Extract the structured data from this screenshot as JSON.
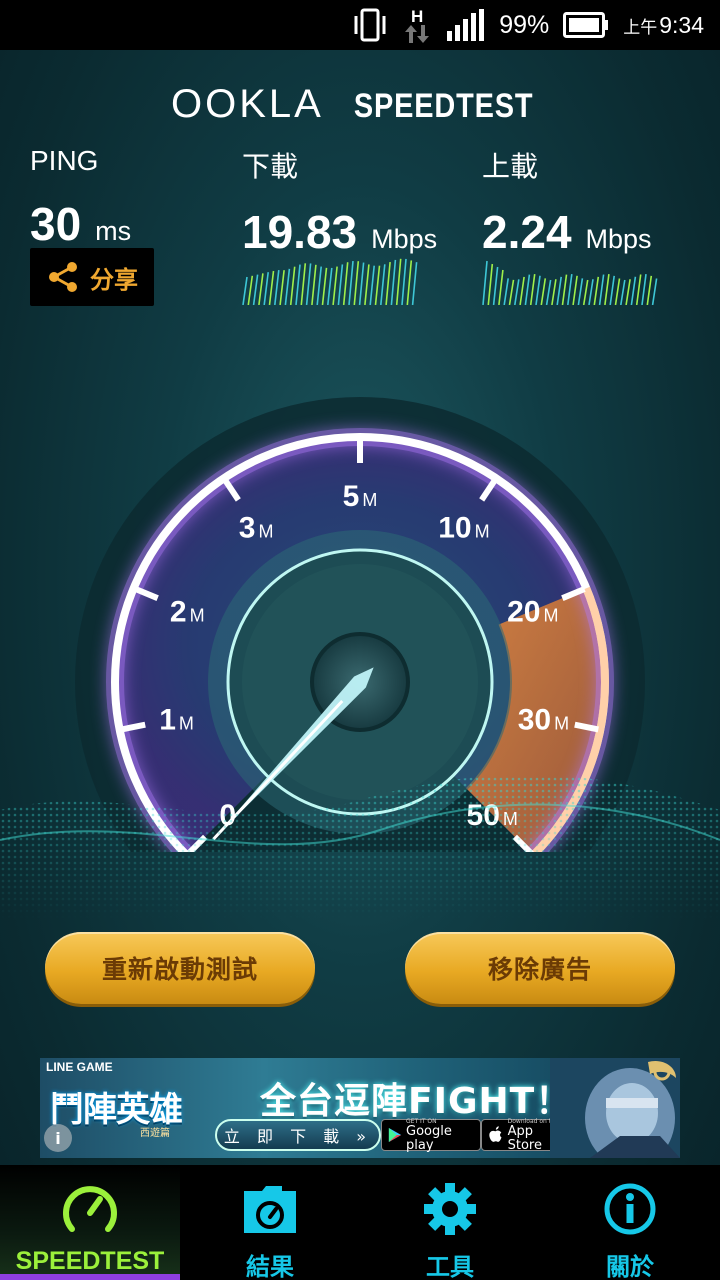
{
  "status_bar": {
    "battery": "99%",
    "time_prefix": "上午",
    "time": "9:34",
    "network": "H"
  },
  "header": {
    "brand": "OOKLA",
    "product": "SPEEDTEST"
  },
  "stats": {
    "ping": {
      "label": "PING",
      "value": "30",
      "unit": "ms"
    },
    "download": {
      "label": "下載",
      "value": "19.83",
      "unit": "Mbps"
    },
    "upload": {
      "label": "上載",
      "value": "2.24",
      "unit": "Mbps"
    }
  },
  "share": {
    "label": "分享"
  },
  "gauge": {
    "ticks": [
      "0",
      "1",
      "2",
      "3",
      "5",
      "10",
      "20",
      "30",
      "50"
    ],
    "tick_unit": "M",
    "needle_value_mbps": 0,
    "colors": {
      "arc": "#ffffff",
      "glow": "#b47cff",
      "high_zone": "#e8873a"
    }
  },
  "buttons": {
    "restart": "重新啟動測試",
    "remove_ads": "移除廣告"
  },
  "ad": {
    "publisher": "LINE GAME",
    "game_title": "鬥陣英雄",
    "game_subtitle": "西遊篇",
    "headline": "全台逗陣FIGHT！",
    "download_cta": "立 即 下 載 »",
    "google_small": "GET IT ON",
    "google_big": "Google play",
    "apple_small": "Download on the",
    "apple_big": "App Store",
    "info_icon": "i"
  },
  "nav": {
    "items": [
      {
        "label": "SPEEDTEST",
        "icon": "speedometer-icon",
        "active": true
      },
      {
        "label": "結果",
        "icon": "results-folder-icon",
        "active": false
      },
      {
        "label": "工具",
        "icon": "gear-icon",
        "active": false
      },
      {
        "label": "關於",
        "icon": "info-icon",
        "active": false
      }
    ],
    "colors": {
      "active": "#9bf03b",
      "inactive": "#16c8e8",
      "indicator": "#8e3fe0"
    }
  }
}
